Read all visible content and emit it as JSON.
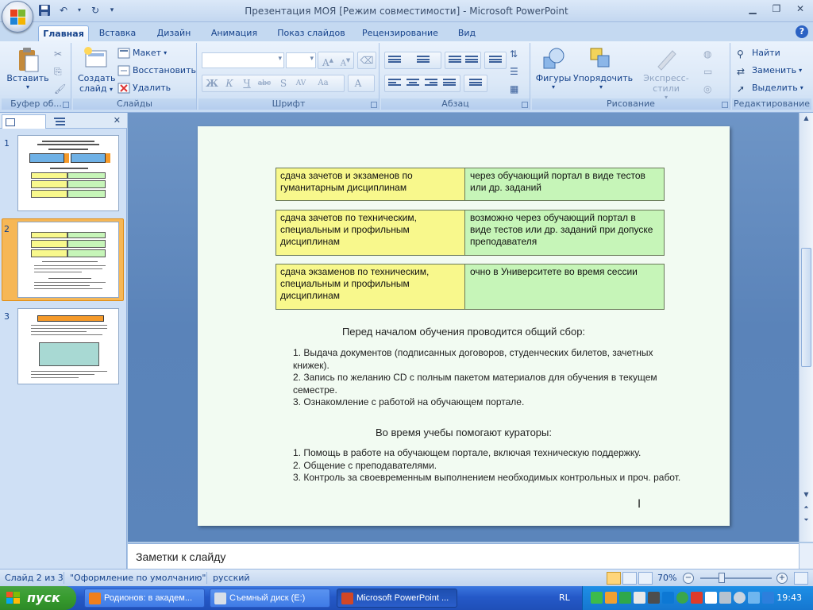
{
  "window": {
    "title": "Презентация МОЯ [Режим совместимости] - Microsoft PowerPoint"
  },
  "tabs": [
    {
      "label": "Главная",
      "active": true
    },
    {
      "label": "Вставка"
    },
    {
      "label": "Дизайн"
    },
    {
      "label": "Анимация"
    },
    {
      "label": "Показ слайдов"
    },
    {
      "label": "Рецензирование"
    },
    {
      "label": "Вид"
    }
  ],
  "ribbon": {
    "clipboard": {
      "paste_label": "Вставить",
      "group_label": "Буфер об..."
    },
    "slides": {
      "create_label_1": "Создать",
      "create_label_2": "слайд",
      "layout_label": "Макет",
      "reset_label": "Восстановить",
      "delete_label": "Удалить",
      "group_label": "Слайды"
    },
    "font": {
      "group_label": "Шрифт"
    },
    "paragraph": {
      "group_label": "Абзац"
    },
    "drawing": {
      "shapes_label": "Фигуры",
      "arrange_label": "Упорядочить",
      "quickstyles_label": "Экспресс-стили",
      "group_label": "Рисование"
    },
    "editing": {
      "find_label": "Найти",
      "replace_label": "Заменить",
      "select_label": "Выделить",
      "group_label": "Редактирование"
    }
  },
  "slides_panel": {
    "thumbs": [
      {
        "num": "1"
      },
      {
        "num": "2"
      },
      {
        "num": "3"
      }
    ]
  },
  "slide": {
    "rows": [
      {
        "left": "сдача зачетов и экзаменов по гуманитарным дисциплинам",
        "right": "через обучающий портал в виде тестов или др. заданий"
      },
      {
        "left": "сдача зачетов по техническим, специальным и профильным дисциплинам",
        "right": "возможно через обучающий портал в виде тестов или др. заданий при допуске преподавателя"
      },
      {
        "left": "сдача экзаменов по техническим, специальным и профильным дисциплинам",
        "right": "очно в Университете во время сессии"
      }
    ],
    "heading1": "Перед началом обучения проводится общий сбор:",
    "list1": [
      "1. Выдача документов (подписанных договоров, студенческих билетов, зачетных книжек).",
      "2. Запись по желанию CD с полным пакетом материалов для обучения в текущем семестре.",
      "3. Ознакомление с работой на обучающем портале."
    ],
    "heading2": "Во время учебы помогают кураторы:",
    "list2": [
      "1. Помощь в работе на обучающем портале, включая техническую поддержку.",
      "2. Общение с преподавателями.",
      "3. Контроль за своевременным выполнением необходимых контрольных и проч. работ."
    ]
  },
  "notes": {
    "placeholder": "Заметки к слайду"
  },
  "status": {
    "slide_counter": "Слайд 2 из 3",
    "theme": "\"Оформление по умолчанию\"",
    "language": "русский",
    "zoom": "70%"
  },
  "taskbar": {
    "start_label": "пуск",
    "items": [
      {
        "label": "Родионов: в академ...",
        "active": false
      },
      {
        "label": "Съемный диск (E:)",
        "active": false
      },
      {
        "label": "Microsoft PowerPoint ...",
        "active": true
      }
    ],
    "lang": "RL",
    "clock": "19:43"
  }
}
